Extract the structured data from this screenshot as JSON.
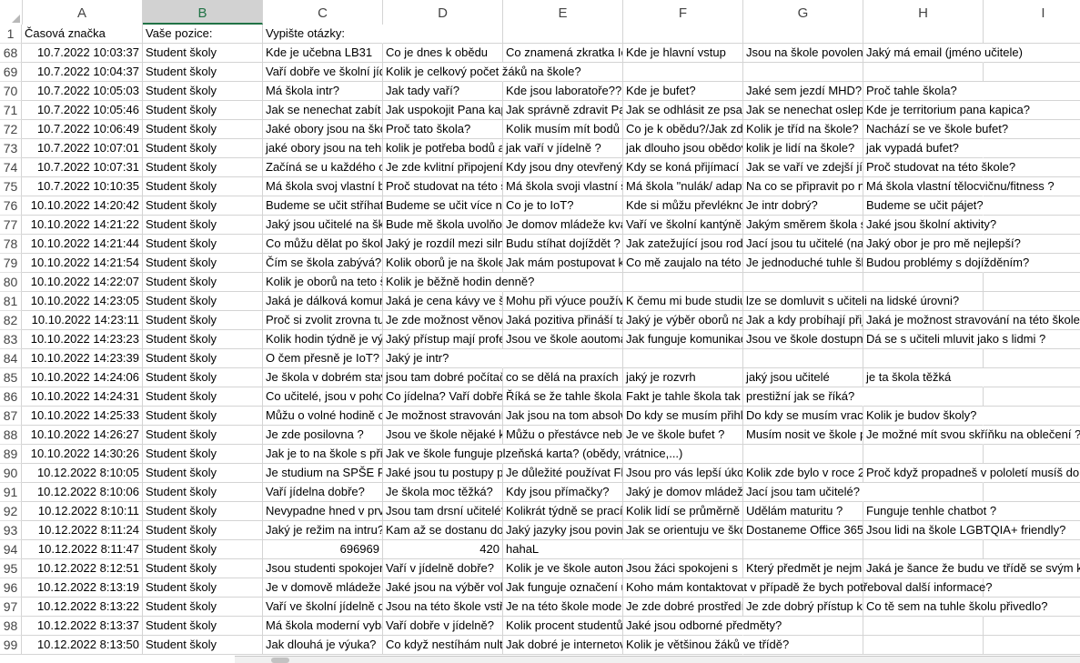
{
  "columns": [
    "A",
    "B",
    "C",
    "D",
    "E",
    "F",
    "G",
    "H",
    "I"
  ],
  "selected_column": "B",
  "header_row": {
    "row": "1",
    "a": "Časová značka",
    "b": "Vaše pozice:",
    "c": "Vypište otázky:"
  },
  "rows": [
    {
      "row": "68",
      "a": "10.7.2022 10:03:37",
      "b": "Student školy",
      "c": "Kde je učebna LB31",
      "d": "Co je dnes k obědu",
      "e": "Co znamená zkratka IoT",
      "f": "Kde je hlavní vstup",
      "g": "Jsou na škole povoleny mobily?",
      "h": "Jaký má email (jméno učitele)",
      "i": ""
    },
    {
      "row": "69",
      "a": "10.7.2022 10:04:37",
      "b": "Student školy",
      "c": "Vaří dobře ve školní jídelně?",
      "d": "Kolik je celkový počet žáků na škole?",
      "e": "",
      "f": "",
      "g": "",
      "h": "",
      "i": ""
    },
    {
      "row": "70",
      "a": "10.7.2022 10:05:03",
      "b": "Student školy",
      "c": "Má škola intr?",
      "d": "Jak tady vaří?",
      "e": "Kde jsou laboratoře??",
      "f": "Kde je bufet?",
      "g": "Jaké sem jezdí MHD?",
      "h": "Proč tahle škola?",
      "i": ""
    },
    {
      "row": "71",
      "a": "10.7.2022 10:05:46",
      "b": "Student školy",
      "c": "Jak se nenechat zabít",
      "d": "Jak uspokojit Pana kapica",
      "e": "Jak správně zdravit Pana kapica",
      "f": "Jak se odhlásit ze psaní",
      "g": "Jak se nenechat oslepit",
      "h": "Kde je territorium pana kapica?",
      "i": ""
    },
    {
      "row": "72",
      "a": "10.7.2022 10:06:49",
      "b": "Student školy",
      "c": "Jaké obory jsou na škole?",
      "d": "Proč tato škola?",
      "e": "Kolik musím mít bodů",
      "f": "Co je k obědu?/Jak zde vaří?",
      "g": "Kolik je tříd na škole?",
      "h": "Nachází se ve škole bufet?",
      "i": ""
    },
    {
      "row": "73",
      "a": "10.7.2022 10:07:01",
      "b": "Student školy",
      "c": "jaké obory jsou na tehle škole",
      "d": "kolik je potřeba bodů a",
      "e": "jak vaří v jídelně ?",
      "f": "jak dlouho jsou obědové fronty",
      "g": "kolik je lidí na škole?",
      "h": "jak vypadá bufet?",
      "i": ""
    },
    {
      "row": "74",
      "a": "10.7.2022 10:07:31",
      "b": "Student školy",
      "c": "Začíná se u každého oboru",
      "d": "Je zde kvlitní připojení",
      "e": "Kdy jsou dny otevřených dveří",
      "f": "Kdy se koná přijímací řízení",
      "g": "Jak se vaří ve zdejší jídelně?",
      "h": "Proč studovat na této škole?",
      "i": ""
    },
    {
      "row": "75",
      "a": "10.7.2022 10:10:35",
      "b": "Student školy",
      "c": "Má škola svoj vlastní bufet",
      "d": "Proč studovat na této škole",
      "e": "Má škola svoji vlastní šatnu",
      "f": "Má škola \"nulák/ adaptační kurz",
      "g": "Na co se připravit po nástupu",
      "h": "Má škola vlastní tělocvičnu/fitness ?",
      "i": ""
    },
    {
      "row": "76",
      "a": "10.10.2022 14:20:42",
      "b": "Student školy",
      "c": "Budeme se učit stříhat",
      "d": "Budeme se učit více na počítači",
      "e": "Co je to IoT?",
      "f": "Kde si můžu převléknout",
      "g": "Je intr dobrý?",
      "h": "Budeme se učit pájet?",
      "i": ""
    },
    {
      "row": "77",
      "a": "10.10.2022 14:21:22",
      "b": "Student školy",
      "c": "Jaký jsou učitelé na škole",
      "d": "Bude mě škola uvolňovat",
      "e": "Je domov mládeže kvalitní",
      "f": "Vaří ve školní kantýně dobře",
      "g": "Jakým směrem škola směřuje",
      "h": "Jaké jsou školní aktivity?",
      "i": ""
    },
    {
      "row": "78",
      "a": "10.10.2022 14:21:44",
      "b": "Student školy",
      "c": "Co můžu dělat po škole",
      "d": "Jaký je rozdíl mezi silnoproudem",
      "e": "Budu stíhat dojíždět ?",
      "f": "Jak zatežující jsou rodiče",
      "g": "Jací jsou tu učitelé (na škole)",
      "h": "Jaký obor je pro mě nejlepší?",
      "i": ""
    },
    {
      "row": "79",
      "a": "10.10.2022 14:21:54",
      "b": "Student školy",
      "c": "Čím se škola zabývá?",
      "d": "Kolik oborů je na škole?",
      "e": "Jak mám postupovat když",
      "f": "Co mě zaujalo na této škole",
      "g": "Je jednoduché tuhle školu",
      "h": "Budou problémy s dojížděním?",
      "i": ""
    },
    {
      "row": "80",
      "a": "10.10.2022 14:22:07",
      "b": "Student školy",
      "c": "Kolik je oborů na teto škole",
      "d": "Kolik je běžně hodin denně?",
      "e": "",
      "f": "",
      "g": "",
      "h": "",
      "i": ""
    },
    {
      "row": "81",
      "a": "10.10.2022 14:23:05",
      "b": "Student školy",
      "c": "Jaká je dálková komunikace",
      "d": "Jaká je cena kávy ve škole",
      "e": "Mohu při výuce používat",
      "f": "K čemu mi bude studium",
      "g": "lze se domluvit s učiteli na lidské úrovni?",
      "h": "",
      "i": ""
    },
    {
      "row": "82",
      "a": "10.10.2022 14:23:11",
      "b": "Student školy",
      "c": "Proč si zvolit zrovna tuto školu",
      "d": "Je zde možnost věnovat se",
      "e": "Jaká pozitiva přináší tato",
      "f": "Jaký je výběr oborů na škole",
      "g": "Jak a kdy probíhají přijímačky",
      "h": "Jaká je možnost stravování na této škole",
      "i": ""
    },
    {
      "row": "83",
      "a": "10.10.2022 14:23:23",
      "b": "Student školy",
      "c": "Kolik hodin týdně je výuka",
      "d": "Jaký přístup mají profesoři",
      "e": "Jsou ve škole aoutomaty",
      "f": "Jak funguje komunikace",
      "g": "Jsou ve škole dostupné",
      "h": "Dá se s učiteli mluvit jako s lidmi ?",
      "i": ""
    },
    {
      "row": "84",
      "a": "10.10.2022 14:23:39",
      "b": "Student školy",
      "c": "O čem přesně je IoT?",
      "d": "Jaký je intr?",
      "e": "",
      "f": "",
      "g": "",
      "h": "",
      "i": ""
    },
    {
      "row": "85",
      "a": "10.10.2022 14:24:06",
      "b": "Student školy",
      "c": "Je škola v dobrém stavu",
      "d": "jsou tam dobré počítače",
      "e": "co se dělá na praxích",
      "f": "jaký je rozvrh",
      "g": "jaký jsou učitelé",
      "h": "je ta škola těžká",
      "i": ""
    },
    {
      "row": "86",
      "a": "10.10.2022 14:24:31",
      "b": "Student školy",
      "c": "Co učitelé, jsou v pohodě",
      "d": "Co jídelna? Vaří dobře?",
      "e": "Říká se že tahle škola",
      "f": "Fakt je tahle škola tak",
      "g": "prestižní jak se říká?",
      "h": "",
      "i": ""
    },
    {
      "row": "87",
      "a": "10.10.2022 14:25:33",
      "b": "Student školy",
      "c": "Můžu o volné hodině odejít",
      "d": "Je možnost stravování",
      "e": "Jak jsou na tom absolventi",
      "f": "Do kdy se musím přihlásit",
      "g": "Do kdy se musím vracet",
      "h": "Kolik je budov školy?",
      "i": ""
    },
    {
      "row": "88",
      "a": "10.10.2022 14:26:27",
      "b": "Student školy",
      "c": "Je zde posilovna ?",
      "d": "Jsou ve škole nějaké kroužky",
      "e": "Můžu o přestávce nebo",
      "f": "Je ve škole bufet ?",
      "g": "Musím nosit ve škole přezůvky",
      "h": "Je možné mít svou skříňku na oblečení ?",
      "i": ""
    },
    {
      "row": "89",
      "a": "10.10.2022 14:30:26",
      "b": "Student školy",
      "c": "Jak je to na škole s přihlášením",
      "d": "Jak ve škole funguje plzeňská karta? (obědy, vrátnice,...)",
      "e": "",
      "f": "",
      "g": "",
      "h": "",
      "i": ""
    },
    {
      "row": "90",
      "a": "10.12.2022 8:10:05",
      "b": "Student školy",
      "c": "Je studium na SPŠE Plzeň",
      "d": "Jaké jsou tu postupy pro",
      "e": "Je důležité používat Flash",
      "f": "Jsou pro vás lepší úkoly",
      "g": "Kolik zde bylo v roce 2020",
      "h": "Proč když propadneš v pololetí musíš do",
      "i": ""
    },
    {
      "row": "91",
      "a": "10.12.2022 8:10:06",
      "b": "Student školy",
      "c": "Vaří jídelna dobře?",
      "d": "Je škola moc těžká?",
      "e": "Kdy jsou přímačky?",
      "f": "Jaký je domov mládeže?",
      "g": "Jací jsou tam učitelé?",
      "h": "",
      "i": ""
    },
    {
      "row": "92",
      "a": "10.12.2022 8:10:11",
      "b": "Student školy",
      "c": "Nevypadne hned v první",
      "d": "Jsou tam drsní učitelé?",
      "e": "Kolikrát týdně se prací",
      "f": "Kolik lidí se průměrně",
      "g": "Udělám maturitu ?",
      "h": "Funguje tenhle chatbot ?",
      "i": ""
    },
    {
      "row": "93",
      "a": "10.12.2022 8:11:24",
      "b": "Student školy",
      "c": "Jaký je režim na intru?",
      "d": "Kam až se dostanu do",
      "e": "Jaký jazyky jsou povinné",
      "f": "Jak se orientuju ve škole",
      "g": "Dostaneme Office 365?",
      "h": "Jsou lidi na škole LGBTQIA+ friendly?",
      "i": ""
    },
    {
      "row": "94",
      "a": "10.12.2022 8:11:47",
      "b": "Student školy",
      "c": "696969",
      "d": "420",
      "e": "hahaL",
      "f": "",
      "g": "",
      "h": "",
      "i": ""
    },
    {
      "row": "95",
      "a": "10.12.2022 8:12:51",
      "b": "Student školy",
      "c": "Jsou studenti spokojení",
      "d": "Vaří v jídelně dobře?",
      "e": "Kolik je ve škole automatů",
      "f": "Jsou žáci spokojeni s",
      "g": "Který předmět je nejmíň",
      "h": "Jaká je šance že budu ve třídě se svým k",
      "i": ""
    },
    {
      "row": "96",
      "a": "10.12.2022 8:13:19",
      "b": "Student školy",
      "c": "Je v domově mládeže",
      "d": "Jaké jsou na výběr volitelné",
      "e": "Jak funguje označení učeben",
      "f": "Koho mám kontaktovat v případě že bych potřeboval další informace?",
      "g": "",
      "h": "",
      "i": ""
    },
    {
      "row": "97",
      "a": "10.12.2022 8:13:22",
      "b": "Student školy",
      "c": "Vaří ve školní jídelně dobře",
      "d": "Jsou na této škole vstřícní",
      "e": "Je na této škole moderní",
      "f": "Je zde dobré prostředí",
      "g": "Je zde dobrý přístup k",
      "h": "Co tě sem na tuhle školu přivedlo?",
      "i": ""
    },
    {
      "row": "98",
      "a": "10.12.2022 8:13:37",
      "b": "Student školy",
      "c": "Má škola moderní vybavení",
      "d": "Vaří dobře v jídelně?",
      "e": "Kolik procent studentů",
      "f": "Jaké jsou odborné předměty?",
      "g": "",
      "h": "",
      "i": ""
    },
    {
      "row": "99",
      "a": "10.12.2022 8:13:50",
      "b": "Student školy",
      "c": "Jak dlouhá je výuka?",
      "d": "Co když nestíhám nultou",
      "e": "Jak dobré je internetové",
      "f": "Kolik je většinou žáků ve třídě?",
      "g": "",
      "h": "",
      "i": ""
    }
  ]
}
